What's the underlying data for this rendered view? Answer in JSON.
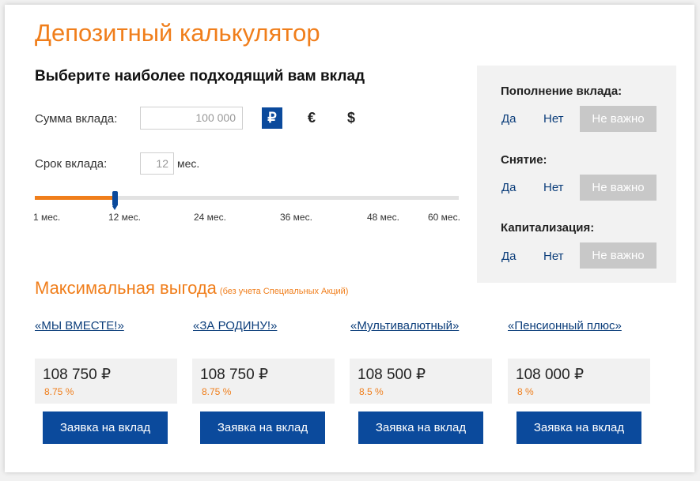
{
  "title": "Депозитный калькулятор",
  "subtitle": "Выберите наиболее подходящий вам вклад",
  "amount": {
    "label": "Сумма вклада:",
    "value": "100 000",
    "currencies": [
      "₽",
      "€",
      "$"
    ],
    "active_currency": "₽"
  },
  "term": {
    "label": "Срок вклада:",
    "value": "12",
    "unit": "мес.",
    "slider_min": 1,
    "slider_max": 60,
    "slider_value": 12,
    "ticks": [
      "1 мес.",
      "12 мес.",
      "24 мес.",
      "36 мес.",
      "48 мес.",
      "60 мес."
    ]
  },
  "filters": [
    {
      "title": "Пополнение вклада:",
      "options": [
        "Да",
        "Нет",
        "Не важно"
      ],
      "selected": "Не важно"
    },
    {
      "title": "Снятие:",
      "options": [
        "Да",
        "Нет",
        "Не важно"
      ],
      "selected": "Не важно"
    },
    {
      "title": "Капитализация:",
      "options": [
        "Да",
        "Нет",
        "Не важно"
      ],
      "selected": "Не важно"
    }
  ],
  "benefit": {
    "title": "Максимальная выгода",
    "note": "(без учета Специальных Акций)"
  },
  "deposits": [
    {
      "name": "«МЫ ВМЕСТЕ!»",
      "amount": "108 750 ₽",
      "rate": "8.75 %",
      "button": "Заявка на вклад"
    },
    {
      "name": "«ЗА РОДИНУ!»",
      "amount": "108 750 ₽",
      "rate": "8.75 %",
      "button": "Заявка на вклад"
    },
    {
      "name": "«Мультивалютный»",
      "amount": "108 500 ₽",
      "rate": "8.5 %",
      "button": "Заявка на вклад"
    },
    {
      "name": "«Пенсионный плюс»",
      "amount": "108 000 ₽",
      "rate": "8 %",
      "button": "Заявка на вклад"
    }
  ],
  "colors": {
    "accent": "#f07e1b",
    "primary": "#0b4a9c",
    "link": "#0b3d7a"
  }
}
